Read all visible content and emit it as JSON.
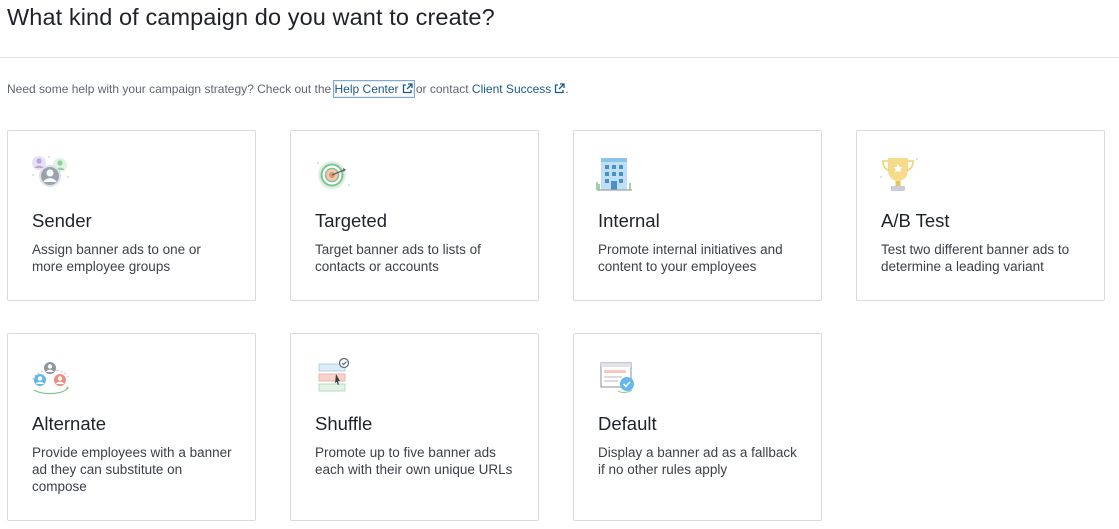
{
  "page": {
    "title": "What kind of campaign do you want to create?"
  },
  "help": {
    "prefix": "Need some help with your campaign strategy? Check out the ",
    "help_center": "Help Center",
    "middle": " or contact ",
    "client_success": "Client Success",
    "suffix": "."
  },
  "cards": [
    {
      "title": "Sender",
      "description": "Assign banner ads to one or more employee groups",
      "icon": "employee-groups-icon"
    },
    {
      "title": "Targeted",
      "description": "Target banner ads to lists of contacts or accounts",
      "icon": "target-icon"
    },
    {
      "title": "Internal",
      "description": "Promote internal initiatives and content to your employees",
      "icon": "building-icon"
    },
    {
      "title": "A/B Test",
      "description": "Test two different banner ads to determine a leading variant",
      "icon": "trophy-icon"
    },
    {
      "title": "Alternate",
      "description": "Provide employees with a banner ad they can substitute on compose",
      "icon": "swap-people-icon"
    },
    {
      "title": "Shuffle",
      "description": "Promote up to five banner ads each with their own unique URLs",
      "icon": "shuffle-banners-icon"
    },
    {
      "title": "Default",
      "description": "Display a banner ad as a fallback if no other rules apply",
      "icon": "default-banner-icon"
    }
  ],
  "colors": {
    "link": "#1a5a8c",
    "border": "#d7dbe0",
    "title_text": "#1f2329"
  }
}
